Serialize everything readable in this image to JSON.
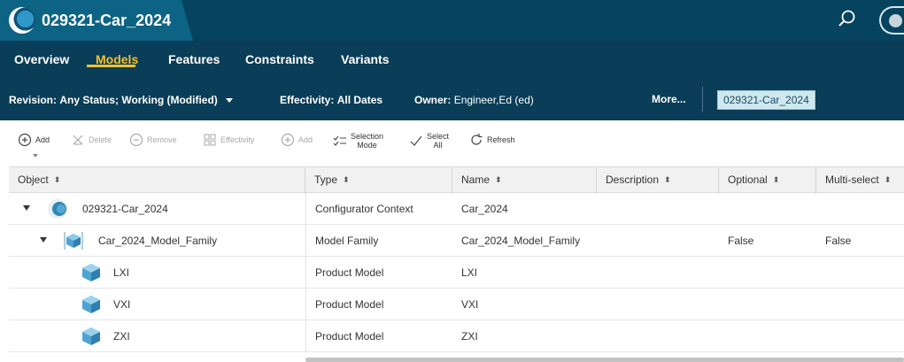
{
  "app": {
    "title": "029321-Car_2024"
  },
  "nav": {
    "tabs": [
      {
        "label": "Overview",
        "active": false
      },
      {
        "label": "Models",
        "active": true
      },
      {
        "label": "Features",
        "active": false
      },
      {
        "label": "Constraints",
        "active": false
      },
      {
        "label": "Variants",
        "active": false
      }
    ]
  },
  "filters": {
    "revision_label": "Revision:",
    "revision_value": "Any Status; Working (Modified)",
    "effectivity_label": "Effectivity:",
    "effectivity_value": "All Dates",
    "owner_label": "Owner:",
    "owner_value": "Engineer,Ed (ed)",
    "more_label": "More...",
    "context_chip": "029321-Car_2024"
  },
  "toolbar": {
    "add_label": "Add",
    "delete_label": "Delete",
    "remove_label": "Remove",
    "effectivity_label": "Effectivity",
    "add2_label": "Add",
    "selection_mode_line1": "Selection",
    "selection_mode_line2": "Mode",
    "select_all_line1": "Select",
    "select_all_line2": "All",
    "refresh_label": "Refresh"
  },
  "table": {
    "columns": [
      "Object",
      "Type",
      "Name",
      "Description",
      "Optional",
      "Multi-select"
    ],
    "sort_glyph": "⬍",
    "rows": [
      {
        "object": "029321-Car_2024",
        "icon": "configurator-context-icon",
        "type": "Configurator Context",
        "name": "Car_2024",
        "description": "",
        "optional": "",
        "multi_select": ""
      },
      {
        "object": "Car_2024_Model_Family",
        "icon": "model-family-icon",
        "type": "Model Family",
        "name": "Car_2024_Model_Family",
        "description": "",
        "optional": "False",
        "multi_select": "False"
      },
      {
        "object": "LXI",
        "icon": "product-model-icon",
        "type": "Product Model",
        "name": "LXI",
        "description": "",
        "optional": "",
        "multi_select": ""
      },
      {
        "object": "VXI",
        "icon": "product-model-icon",
        "type": "Product Model",
        "name": "VXI",
        "description": "",
        "optional": "",
        "multi_select": ""
      },
      {
        "object": "ZXI",
        "icon": "product-model-icon",
        "type": "Product Model",
        "name": "ZXI",
        "description": "",
        "optional": "",
        "multi_select": ""
      }
    ]
  },
  "colors": {
    "header_dark": "#06435e",
    "title_tab": "#0c6383",
    "nav_bg": "#0a3d57",
    "active_tab": "#f5c02e",
    "chip_bg": "#cfe8ef"
  }
}
